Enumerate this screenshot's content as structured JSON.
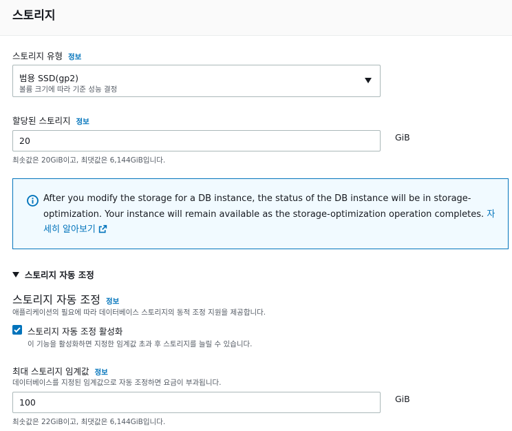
{
  "header": {
    "title": "스토리지"
  },
  "storage_type": {
    "label": "스토리지 유형",
    "info": "정보",
    "selected_value": "범용 SSD(gp2)",
    "selected_description": "볼륨 크기에 따라 기준 성능 결정"
  },
  "allocated_storage": {
    "label": "할당된 스토리지",
    "info": "정보",
    "value": "20",
    "unit": "GiB",
    "constraint": "최솟값은 20GiB이고, 최댓값은 6,144GiB입니다."
  },
  "alert": {
    "text": "After you modify the storage for a DB instance, the status of the DB instance will be in storage-optimization. Your instance will remain available as the storage-optimization operation completes.",
    "link_text": "자세히 알아보기"
  },
  "autoscaling": {
    "expander_label": "스토리지 자동 조정",
    "section_title": "스토리지 자동 조정",
    "info": "정보",
    "description": "애플리케이션의 필요에 따라 데이터베이스 스토리지의 동적 조정 지원을 제공합니다.",
    "checkbox_label": "스토리지 자동 조정 활성화",
    "checkbox_checked": true,
    "checkbox_description": "이 기능을 활성화하면 지정한 임계값 초과 후 스토리지를 늘릴 수 있습니다."
  },
  "max_threshold": {
    "label": "최대 스토리지 임계값",
    "info": "정보",
    "description": "데이터베이스를 지정된 임계값으로 자동 조정하면 요금이 부과됩니다.",
    "value": "100",
    "unit": "GiB",
    "constraint": "최솟값은 22GiB이고, 최댓값은 6,144GiB입니다."
  },
  "colors": {
    "accent": "#0073bb",
    "alert_bg": "#f1faff"
  }
}
